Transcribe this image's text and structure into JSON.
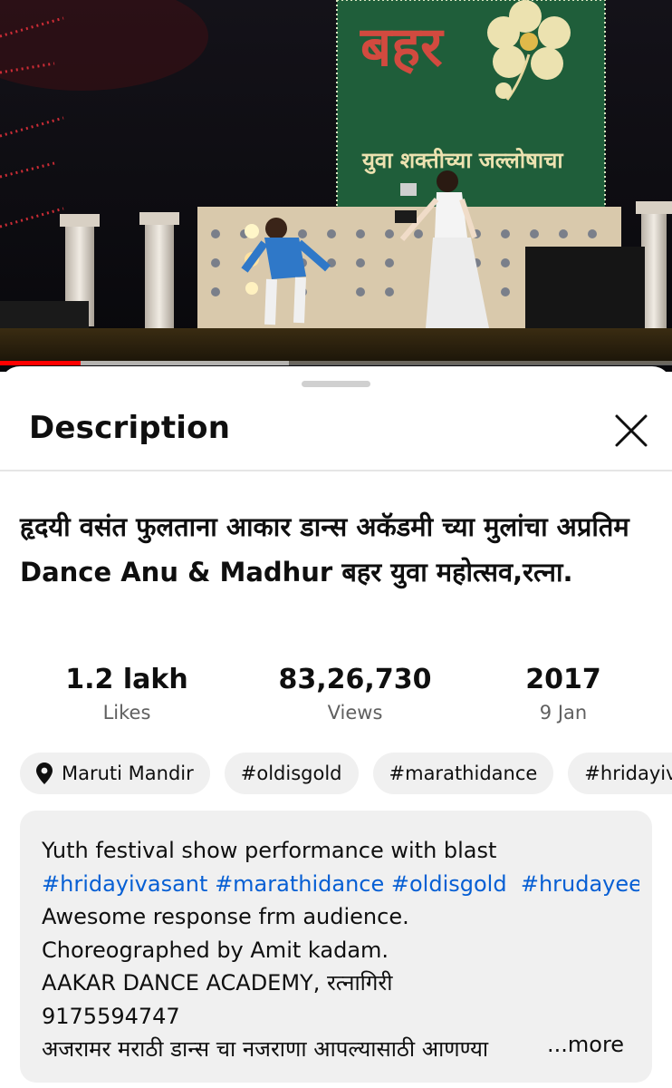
{
  "video": {
    "banner_text": "बहर",
    "banner_subtext": "युवा शक्तीच्या जल्लोषाचा",
    "progress_fraction": 0.12,
    "buffered_fraction": 0.43
  },
  "sheet": {
    "title": "Description"
  },
  "video_title": "हृदयी वसंत फुलताना आकार डान्स अकॅडमी च्या मुलांचा अप्रतिम Dance Anu & Madhur बहर युवा महोत्सव,रत्ना.",
  "stats": {
    "likes_value": "1.2 lakh",
    "likes_label": "Likes",
    "views_value": "83,26,730",
    "views_label": "Views",
    "year_value": "2017",
    "date_label": "9 Jan"
  },
  "chips": {
    "location": "Maruti Mandir",
    "tag1": "#oldisgold",
    "tag2": "#marathidance",
    "tag3": "#hridayivasant"
  },
  "description": {
    "line1": "Yuth festival show performance with blast",
    "hashtags": [
      "#hridayivasant",
      "#marathidance",
      "#oldisgold",
      "#hrudayee"
    ],
    "line3": "Awesome response frm audience.",
    "line4": "Choreographed by Amit kadam.",
    "line5": "AAKAR DANCE ACADEMY, रत्नागिरी",
    "line6": "9175594747",
    "line7": "अजरामर मराठी डान्स चा नजराणा आपल्यासाठी आणण्या",
    "more_label": "...more"
  },
  "colors": {
    "accent_link": "#065fd4",
    "progress_red": "#ff0000",
    "chip_bg": "#f0f0f0",
    "banner_green": "#1f5e3a"
  }
}
